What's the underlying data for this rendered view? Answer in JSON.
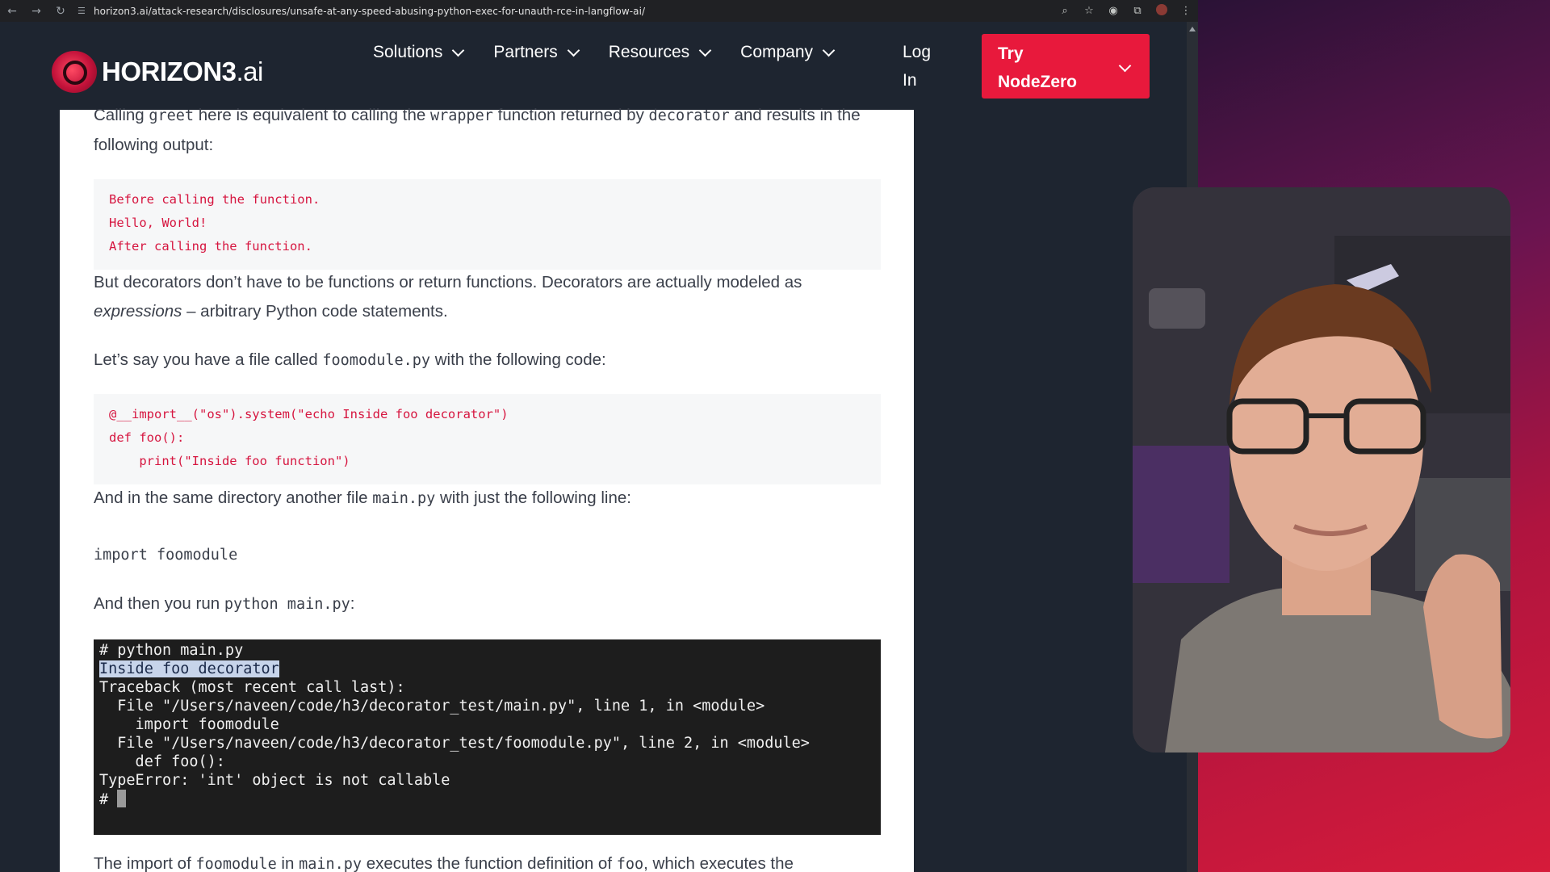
{
  "browser": {
    "url": "horizon3.ai/attack-research/disclosures/unsafe-at-any-speed-abusing-python-exec-for-unauth-rce-in-langflow-ai/"
  },
  "site": {
    "logo_brand": "HORIZON3",
    "logo_suffix": ".ai",
    "nav": [
      "Solutions",
      "Partners",
      "Resources",
      "Company"
    ],
    "login_label": "Log In",
    "cta_label": "Try NodeZero"
  },
  "article": {
    "p1": {
      "a": "Calling ",
      "c1": "greet",
      "b": " here is equivalent to calling the ",
      "c2": "wrapper",
      "c": " function returned by ",
      "c3": "decorator",
      "d": " and results in the following output:"
    },
    "output_lines": [
      "Before calling the function.",
      "Hello, World!",
      "After calling the function."
    ],
    "p2": {
      "a": "But decorators don’t have to be functions or return functions. Decorators are actually modeled as ",
      "em": "expressions",
      "b": " – arbitrary Python code statements."
    },
    "p3": {
      "a": "Let’s say you have a file called ",
      "c1": "foomodule.py",
      "b": " with the following code:"
    },
    "code_lines": [
      "@__import__(\"os\").system(\"echo Inside foo decorator\")",
      "def foo():",
      "    print(\"Inside foo function\")"
    ],
    "p4": {
      "a": "And in the same directory another file ",
      "c1": "main.py",
      "b": " with just the following line:"
    },
    "import_line": "import foomodule",
    "p5": {
      "a": "And then you run ",
      "c1": "python main.py",
      "b": ":"
    },
    "terminal": {
      "line1": "# python main.py",
      "highlighted": "Inside foo decorator",
      "lines": [
        "Traceback (most recent call last):",
        "  File \"/Users/naveen/code/h3/decorator_test/main.py\", line 1, in <module>",
        "    import foomodule",
        "  File \"/Users/naveen/code/h3/decorator_test/foomodule.py\", line 2, in <module>",
        "    def foo():",
        "TypeError: 'int' object is not callable"
      ],
      "prompt": "# "
    },
    "p6": {
      "a": "The import of ",
      "c1": "foomodule",
      "b": " in ",
      "c2": "main.py",
      "c": " executes the function definition of ",
      "c3": "foo",
      "d": ", which executes the"
    }
  }
}
